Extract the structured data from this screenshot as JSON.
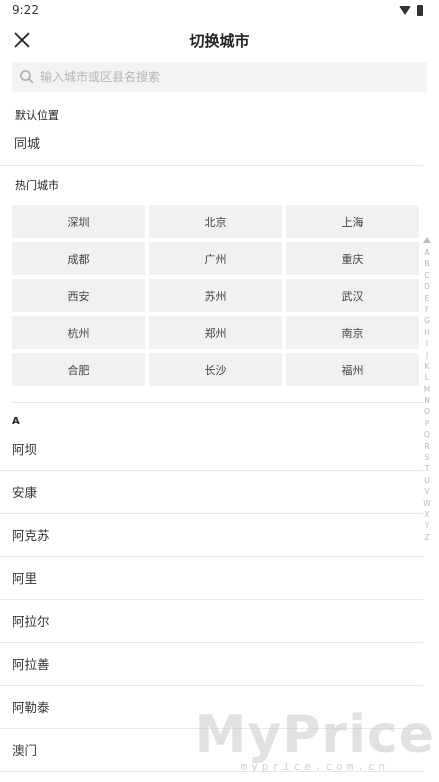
{
  "status_bar": {
    "time": "9:22"
  },
  "header": {
    "title": "切换城市"
  },
  "search": {
    "placeholder": "输入城市或区县名搜索"
  },
  "default_location": {
    "label": "默认位置",
    "city": "同城"
  },
  "hot_cities": {
    "label": "热门城市",
    "items": [
      "深圳",
      "北京",
      "上海",
      "成都",
      "广州",
      "重庆",
      "西安",
      "苏州",
      "武汉",
      "杭州",
      "郑州",
      "南京",
      "合肥",
      "长沙",
      "福州"
    ]
  },
  "city_group": {
    "letter": "A",
    "cities": [
      "阿坝",
      "安康",
      "阿克苏",
      "阿里",
      "阿拉尔",
      "阿拉善",
      "阿勒泰",
      "澳门"
    ]
  },
  "index_letters": [
    "A",
    "B",
    "C",
    "D",
    "E",
    "F",
    "G",
    "H",
    "I",
    "J",
    "K",
    "L",
    "M",
    "N",
    "O",
    "P",
    "Q",
    "R",
    "S",
    "T",
    "U",
    "V",
    "W",
    "X",
    "Y",
    "Z"
  ],
  "watermark": {
    "main": "MyPrice",
    "sub": "myprice.com.cn"
  },
  "colors": {
    "cell_bg": "#f1f1f1",
    "divider": "#e8e8e8",
    "index": "#b8b8b8"
  }
}
